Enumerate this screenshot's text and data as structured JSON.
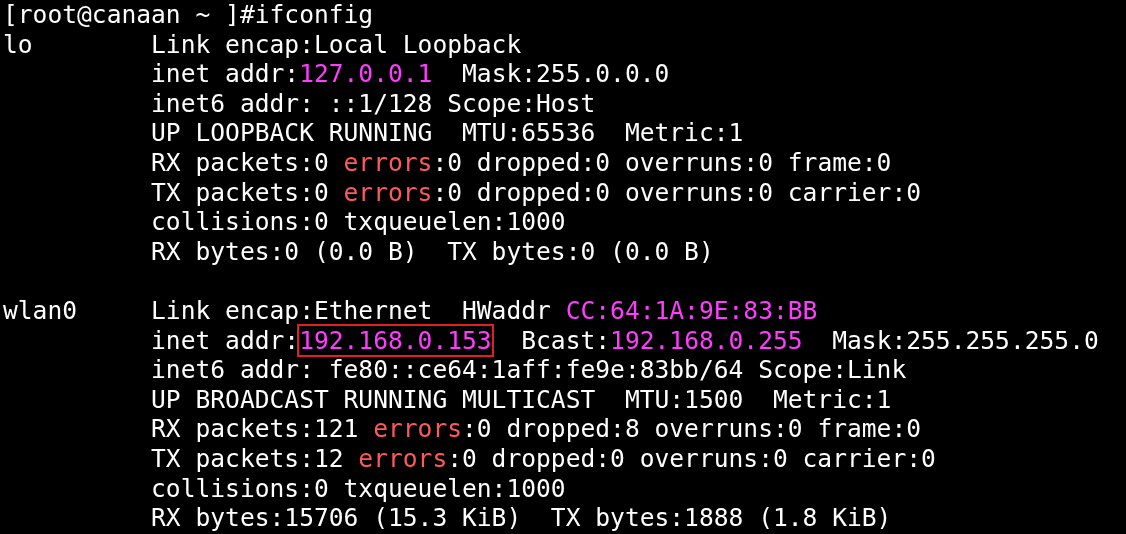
{
  "prompt": "[root@canaan ~ ]#ifconfig",
  "interfaces": [
    {
      "name": "lo",
      "lines": [
        [
          {
            "kind": "text",
            "text": "Link encap:Local Loopback"
          }
        ],
        [
          {
            "kind": "text",
            "text": "inet addr:"
          },
          {
            "kind": "address",
            "text": "127.0.0.1"
          },
          {
            "kind": "text",
            "text": "  Mask:255.0.0.0"
          }
        ],
        [
          {
            "kind": "text",
            "text": "inet6 addr: ::1/128 Scope:Host"
          }
        ],
        [
          {
            "kind": "text",
            "text": "UP LOOPBACK RUNNING  MTU:65536  Metric:1"
          }
        ],
        [
          {
            "kind": "text",
            "text": "RX packets:0 "
          },
          {
            "kind": "error",
            "text": "errors"
          },
          {
            "kind": "text",
            "text": ":0 dropped:0 overruns:0 frame:0"
          }
        ],
        [
          {
            "kind": "text",
            "text": "TX packets:0 "
          },
          {
            "kind": "error",
            "text": "errors"
          },
          {
            "kind": "text",
            "text": ":0 dropped:0 overruns:0 carrier:0"
          }
        ],
        [
          {
            "kind": "text",
            "text": "collisions:0 txqueuelen:1000"
          }
        ],
        [
          {
            "kind": "text",
            "text": "RX bytes:0 (0.0 B)  TX bytes:0 (0.0 B)"
          }
        ]
      ]
    },
    {
      "name": "wlan0",
      "lines": [
        [
          {
            "kind": "text",
            "text": "Link encap:Ethernet  HWaddr "
          },
          {
            "kind": "address",
            "text": "CC:64:1A:9E:83:BB"
          }
        ],
        [
          {
            "kind": "text",
            "text": "inet addr:"
          },
          {
            "kind": "boxed_address",
            "text": "192.168.0.153"
          },
          {
            "kind": "text",
            "text": "  Bcast:"
          },
          {
            "kind": "address",
            "text": "192.168.0.255"
          },
          {
            "kind": "text",
            "text": "  Mask:255.255.255.0"
          }
        ],
        [
          {
            "kind": "text",
            "text": "inet6 addr: fe80::ce64:1aff:fe9e:83bb/64 Scope:Link"
          }
        ],
        [
          {
            "kind": "text",
            "text": "UP BROADCAST RUNNING MULTICAST  MTU:1500  Metric:1"
          }
        ],
        [
          {
            "kind": "text",
            "text": "RX packets:121 "
          },
          {
            "kind": "error",
            "text": "errors"
          },
          {
            "kind": "text",
            "text": ":0 dropped:8 overruns:0 frame:0"
          }
        ],
        [
          {
            "kind": "text",
            "text": "TX packets:12 "
          },
          {
            "kind": "error",
            "text": "errors"
          },
          {
            "kind": "text",
            "text": ":0 dropped:0 overruns:0 carrier:0"
          }
        ],
        [
          {
            "kind": "text",
            "text": "collisions:0 txqueuelen:1000"
          }
        ],
        [
          {
            "kind": "text",
            "text": "RX bytes:15706 (15.3 KiB)  TX bytes:1888 (1.8 KiB)"
          }
        ]
      ]
    }
  ]
}
